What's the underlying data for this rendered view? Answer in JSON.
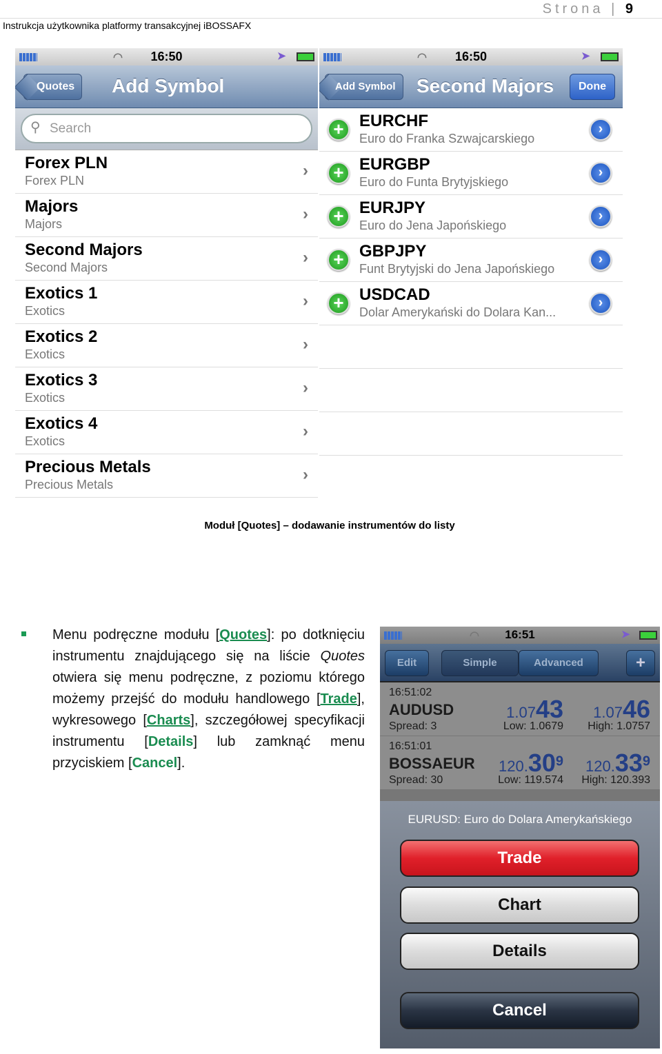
{
  "header": {
    "title": "Instrukcja użytkownika platformy transakcyjnej iBOSSAFX",
    "page_label": "Strona",
    "page_number": "9"
  },
  "phone1": {
    "time": "16:50",
    "back": "Quotes",
    "title": "Add Symbol",
    "search_placeholder": "Search",
    "rows": [
      {
        "t": "Forex PLN",
        "s": "Forex PLN"
      },
      {
        "t": "Majors",
        "s": "Majors"
      },
      {
        "t": "Second Majors",
        "s": "Second Majors"
      },
      {
        "t": "Exotics 1",
        "s": "Exotics"
      },
      {
        "t": "Exotics 2",
        "s": "Exotics"
      },
      {
        "t": "Exotics 3",
        "s": "Exotics"
      },
      {
        "t": "Exotics 4",
        "s": "Exotics"
      },
      {
        "t": "Precious Metals",
        "s": "Precious Metals"
      }
    ]
  },
  "phone2": {
    "time": "16:50",
    "back": "Add Symbol",
    "title": "Second Majors",
    "done": "Done",
    "rows": [
      {
        "t": "EURCHF",
        "s": "Euro do Franka Szwajcarskiego"
      },
      {
        "t": "EURGBP",
        "s": "Euro do Funta Brytyjskiego"
      },
      {
        "t": "EURJPY",
        "s": "Euro do Jena Japońskiego"
      },
      {
        "t": "GBPJPY",
        "s": "Funt Brytyjski do Jena Japońskiego"
      },
      {
        "t": "USDCAD",
        "s": "Dolar Amerykański do Dolara Kan..."
      }
    ]
  },
  "caption": "Moduł [Quotes] – dodawanie instrumentów do listy",
  "paragraph": {
    "p1": "Menu podręczne modułu [",
    "quotes": "Quotes",
    "p2": "]: po dotknięciu instrumentu znajdującego się na liście ",
    "quotes_italic": "Quotes",
    "p3": " otwiera się menu podręczne, z poziomu którego możemy przejść do  modułu handlowego [",
    "trade": "Trade",
    "p4": "], wykresowego [",
    "charts": "Charts",
    "p5": "], szczegółowej specyfikacji instrumentu [",
    "details": "Details",
    "p6": "] lub zamknąć menu przyciskiem [",
    "cancel": "Cancel",
    "p7": "]."
  },
  "phone3": {
    "time": "16:51",
    "edit": "Edit",
    "simple": "Simple",
    "advanced": "Advanced",
    "add": "+",
    "quotes": [
      {
        "time": "16:51:02",
        "sym": "AUDUSD",
        "spread": "Spread: 3",
        "bid_pre": "1.07",
        "bid_big": "43",
        "bid_sup": "",
        "ask_pre": "1.07",
        "ask_big": "46",
        "ask_sup": "",
        "low": "Low: 1.0679",
        "high": "High: 1.0757"
      },
      {
        "time": "16:51:01",
        "sym": "BOSSAEUR",
        "spread": "Spread: 30",
        "bid_pre": "120.",
        "bid_big": "30",
        "bid_sup": "9",
        "ask_pre": "120.",
        "ask_big": "33",
        "ask_sup": "9",
        "low": "Low: 119.574",
        "high": "High: 120.393"
      }
    ],
    "sheet_title": "EURUSD: Euro do Dolara Amerykańskiego",
    "trade": "Trade",
    "chart": "Chart",
    "details": "Details",
    "cancel": "Cancel"
  }
}
